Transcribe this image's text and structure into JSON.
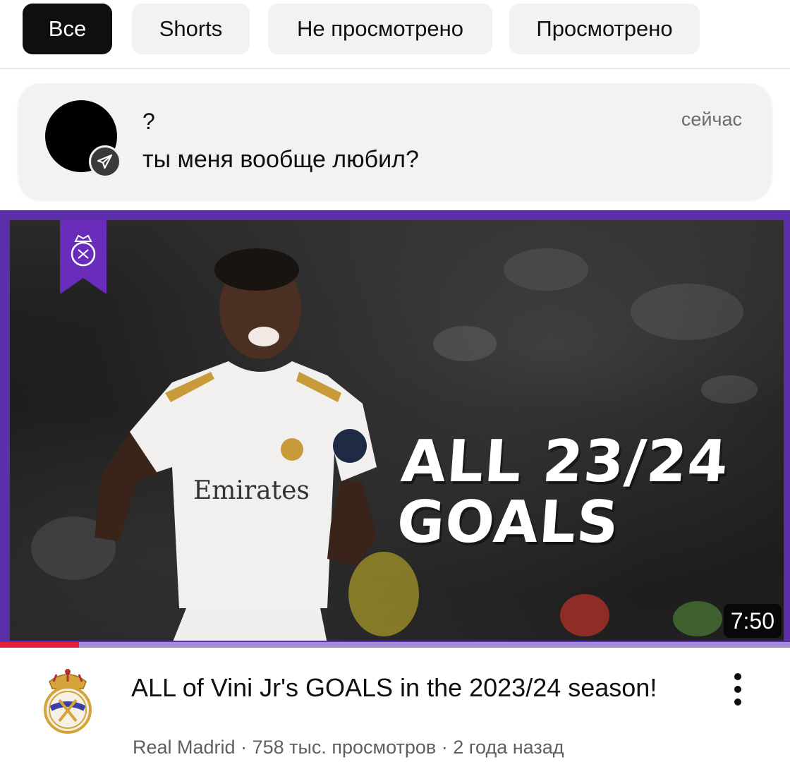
{
  "chips": [
    {
      "label": "Все",
      "active": true
    },
    {
      "label": "Shorts",
      "active": false
    },
    {
      "label": "Не просмотрено",
      "active": false
    },
    {
      "label": "Просмотрено",
      "active": false
    }
  ],
  "notification": {
    "title": "?",
    "text": "ты меня вообще любил?",
    "time": "сейчас",
    "app_icon": "telegram-icon"
  },
  "video": {
    "thumbnail_headline_line1": "ALL 23/24",
    "thumbnail_headline_line2": "GOALS",
    "duration": "7:50",
    "progress_percent": 10,
    "title": "ALL of Vini Jr's GOALS in the 2023/24 season!",
    "channel": "Real Madrid",
    "views": "758 тыс. просмотров",
    "age": "2 года назад",
    "separator": " · "
  },
  "colors": {
    "chip_active_bg": "#0f0f0f",
    "chip_bg": "#f2f2f2",
    "thumbnail_frame": "#5b2fa8",
    "progress": "#e0223a"
  }
}
